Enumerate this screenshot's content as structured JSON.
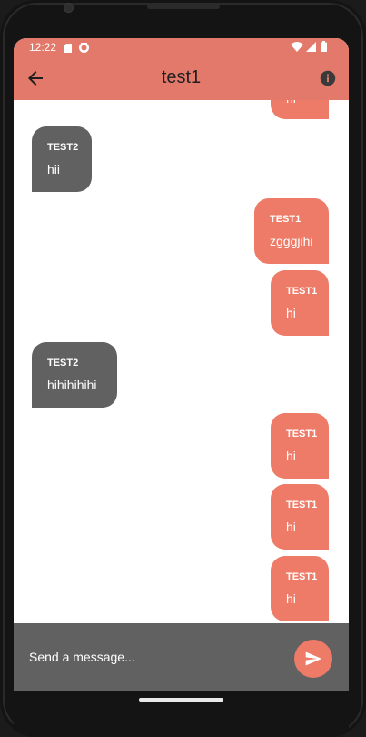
{
  "status_bar": {
    "time": "12:22"
  },
  "app_bar": {
    "title": "test1"
  },
  "messages": [
    {
      "sender": "",
      "text": "hi",
      "side": "right"
    },
    {
      "sender": "TEST2",
      "text": "hii",
      "side": "left"
    },
    {
      "sender": "TEST1",
      "text": "zgggjihi",
      "side": "right"
    },
    {
      "sender": "TEST1",
      "text": "hi",
      "side": "right"
    },
    {
      "sender": "TEST2",
      "text": "hihihihihi",
      "side": "left"
    },
    {
      "sender": "TEST1",
      "text": "hi",
      "side": "right"
    },
    {
      "sender": "TEST1",
      "text": "hi",
      "side": "right"
    },
    {
      "sender": "TEST1",
      "text": "hi",
      "side": "right"
    }
  ],
  "composer": {
    "placeholder": "Send a message..."
  },
  "colors": {
    "accent": "#e3796a",
    "own_bubble": "#ee7a68",
    "other_bubble": "#616161",
    "composer_bg": "#616161"
  },
  "icons": {
    "back": "arrow-left-icon",
    "info": "info-icon",
    "send": "send-icon",
    "status": [
      "sd-card-icon",
      "sync-icon",
      "wifi-icon",
      "signal-icon",
      "battery-icon"
    ]
  }
}
